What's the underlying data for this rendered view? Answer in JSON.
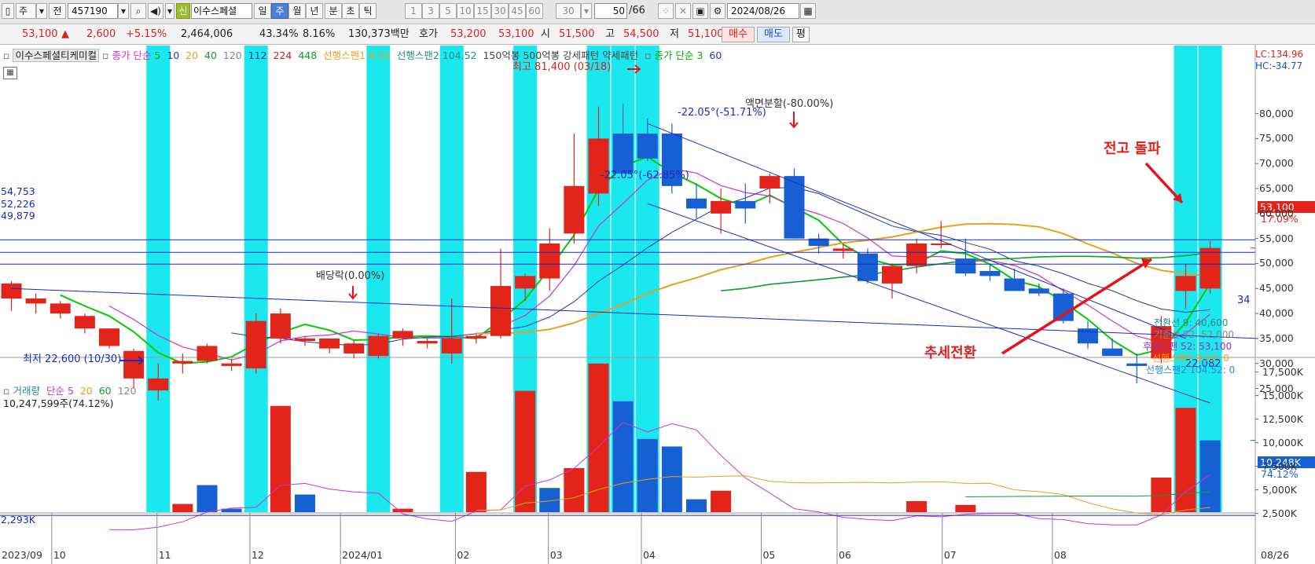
{
  "toolbar": {
    "period_unit": "주",
    "prev_label": "전",
    "stock_code": "457190",
    "market_badge": "신",
    "stock_name_short": "이수스페셜",
    "tabs": [
      "일",
      "주",
      "월",
      "년",
      "분",
      "초",
      "틱"
    ],
    "active_tab": "주",
    "interval_buttons": [
      "1",
      "3",
      "5",
      "10",
      "15",
      "30",
      "45",
      "60"
    ],
    "interval_select": "30",
    "count_value": "50",
    "count_total": "/66",
    "date_value": "2024/08/26"
  },
  "quote": {
    "price": "53,100",
    "change_arrow": "▲",
    "change": "2,600",
    "change_pct": "+5.15%",
    "volume": "2,464,006",
    "volume_ratio": "43.34%",
    "turnover": "8.16%",
    "amount": "130,373백만",
    "bid_label": "호가",
    "bid1": "53,200",
    "bid2": "53,100",
    "open_label": "시",
    "open": "51,500",
    "high_label": "고",
    "high": "54,500",
    "low_label": "저",
    "low": "51,100",
    "buy_label": "매수",
    "sell_label": "매도",
    "eval_label": "평"
  },
  "legend": {
    "name": "이수스페셜티케미컬",
    "ma_label": "종가 단순",
    "ma_periods": [
      "5",
      "10",
      "20",
      "40",
      "120",
      "112",
      "224",
      "448"
    ],
    "ichimoku_a": "선행스팬1 9.52",
    "ichimoku_b": "선행스팬2 104.52",
    "pattern_text": "150억봉 500억봉 강세패턴 약세패턴",
    "ma2_label": "종가 단순 3",
    "ma2_period": "60",
    "lc": "LC:134.96",
    "hc": "HC:-34.77"
  },
  "price_axis": [
    "80,000",
    "75,000",
    "70,000",
    "65,000",
    "60,000",
    "55,000",
    "50,000",
    "45,000",
    "40,000",
    "35,000",
    "30,000",
    "25,000"
  ],
  "volume_axis": [
    "17,500K",
    "15,000K",
    "12,500K",
    "10,000K",
    "7,500K",
    "5,000K",
    "2,500K"
  ],
  "time_axis": [
    "2023/09",
    "10",
    "11",
    "12",
    "2024/01",
    "02",
    "03",
    "04",
    "05",
    "06",
    "07",
    "08",
    "08/26"
  ],
  "levels": {
    "l1": "54,753",
    "l2": "52,226",
    "l3": "49,879",
    "vol_level": "2,293K"
  },
  "current_tags": {
    "price": "53,100",
    "pct": "17.09%",
    "volume": "10,248K",
    "volume_pct": "74.12%"
  },
  "annotations": {
    "high": "최고 81,400 (03/18)",
    "low": "최저 22,600 (10/30)",
    "dividend": "배당락(0.00%)",
    "split": "액면분할(-80.00%)",
    "trend1": "-22.05°(-51.71%)",
    "trend2": "-22.05°(-62.85%)",
    "breakout": "전고 돌파",
    "reversal": "추세전환",
    "trend_end": "34",
    "low_val": "22,082"
  },
  "ichimoku_info": {
    "conversion": "전환선 9: 40,600",
    "base": "기준선 52: 52,000",
    "lagging": "후행스팬 52: 53,100",
    "span_a": "선행스팬1 9.52: 0",
    "span_b": "선행스팬2 104.52: 0"
  },
  "volume_legend": {
    "title": "거래량",
    "ma_label": "단순",
    "periods": [
      "5",
      "20",
      "60",
      "120"
    ],
    "current": "10,247,599주(74.12%)"
  },
  "colors": {
    "up": "#e3241b",
    "down": "#1760d4",
    "highlight": "#1be8ee",
    "ma5": "#00cc00",
    "ma10": "#cc33cc",
    "ma20": "#1a3ea8",
    "ma40": "#e8a020",
    "ma60": "#149c34",
    "trend": "#1a2bc0",
    "arrow": "#e8111a"
  },
  "chart_data": {
    "type": "candlestick",
    "ohlc": [
      [
        43000,
        46500,
        40500,
        46000
      ],
      [
        42000,
        44000,
        40000,
        43000
      ],
      [
        40000,
        42500,
        39000,
        42000
      ],
      [
        37000,
        40000,
        36000,
        39500
      ],
      [
        33500,
        37000,
        33000,
        37000
      ],
      [
        27000,
        33000,
        25000,
        32500
      ],
      [
        24600,
        30000,
        22600,
        27000
      ],
      [
        30000,
        32000,
        28000,
        30500
      ],
      [
        30500,
        34000,
        30000,
        33500
      ],
      [
        29500,
        31000,
        28500,
        30000
      ],
      [
        29000,
        40000,
        28000,
        38500
      ],
      [
        35000,
        41000,
        34000,
        40000
      ],
      [
        34500,
        35500,
        33500,
        35000
      ],
      [
        33000,
        35000,
        32000,
        35000
      ],
      [
        32000,
        34500,
        31000,
        34000
      ],
      [
        31500,
        36000,
        31000,
        35500
      ],
      [
        35000,
        37000,
        33500,
        36500
      ],
      [
        34000,
        35000,
        33000,
        34500
      ],
      [
        32000,
        43000,
        30000,
        35000
      ],
      [
        35000,
        36000,
        34000,
        35500
      ],
      [
        35500,
        53000,
        35000,
        45500
      ],
      [
        45000,
        48000,
        42500,
        47500
      ],
      [
        47000,
        57000,
        44500,
        54000
      ],
      [
        56000,
        76000,
        54000,
        65500
      ],
      [
        64000,
        81400,
        61500,
        75000
      ],
      [
        76000,
        82000,
        72000,
        68000
      ],
      [
        76000,
        79000,
        70500,
        71000
      ],
      [
        76000,
        78000,
        64000,
        65500
      ],
      [
        63000,
        66000,
        59000,
        61000
      ],
      [
        60000,
        65000,
        56000,
        62500
      ],
      [
        62500,
        66000,
        58000,
        61000
      ],
      [
        65000,
        68000,
        62000,
        67500
      ],
      [
        67500,
        69000,
        55000,
        55000
      ],
      [
        55000,
        56000,
        52000,
        53500
      ],
      [
        52500,
        54000,
        51000,
        53000
      ],
      [
        52000,
        53000,
        46000,
        46500
      ],
      [
        46000,
        50000,
        43000,
        49500
      ],
      [
        49500,
        55000,
        48000,
        54000
      ],
      [
        54000,
        58500,
        53000,
        54000
      ],
      [
        51000,
        55000,
        47500,
        48000
      ],
      [
        48500,
        50000,
        46500,
        47500
      ],
      [
        47000,
        49000,
        44500,
        44500
      ],
      [
        45000,
        46000,
        43500,
        44000
      ],
      [
        44000,
        45000,
        38000,
        38500
      ],
      [
        37000,
        38500,
        33000,
        34000
      ],
      [
        33000,
        35000,
        31500,
        31500
      ],
      [
        30000,
        32000,
        26000,
        29500
      ],
      [
        31000,
        39500,
        30000,
        37500
      ],
      [
        44500,
        50000,
        41000,
        47500
      ],
      [
        45000,
        54500,
        44000,
        53100
      ]
    ],
    "volume_k": [
      1200,
      800,
      600,
      400,
      900,
      1100,
      2200,
      3500,
      5500,
      3000,
      1500,
      13900,
      4500,
      2500,
      1500,
      800,
      3000,
      1800,
      1200,
      6900,
      1500,
      15500,
      5200,
      7300,
      18400,
      14400,
      10400,
      9600,
      4000,
      4900,
      2400,
      2400,
      1300,
      2300,
      2000,
      1300,
      1800,
      3800,
      1800,
      3400,
      1700,
      1800,
      1000,
      1300,
      1300,
      1000,
      1800,
      6300,
      13700,
      10248
    ],
    "volume_direction": [
      "d",
      "d",
      "d",
      "d",
      "u",
      "u",
      "u",
      "u",
      "d",
      "d",
      "d",
      "u",
      "d",
      "d",
      "d",
      "d",
      "u",
      "d",
      "d",
      "u",
      "d",
      "u",
      "d",
      "u",
      "u",
      "d",
      "d",
      "d",
      "d",
      "u",
      "d",
      "u",
      "d",
      "u",
      "d",
      "u",
      "u",
      "u",
      "d",
      "u",
      "u",
      "d",
      "u",
      "d",
      "u",
      "d",
      "u",
      "u",
      "u",
      "d"
    ],
    "highlight_bars": [
      6,
      10,
      15,
      18,
      21,
      24,
      25,
      26,
      48,
      49
    ],
    "ylim": [
      20000,
      85000
    ],
    "volume_ylim": [
      0,
      20000
    ]
  }
}
